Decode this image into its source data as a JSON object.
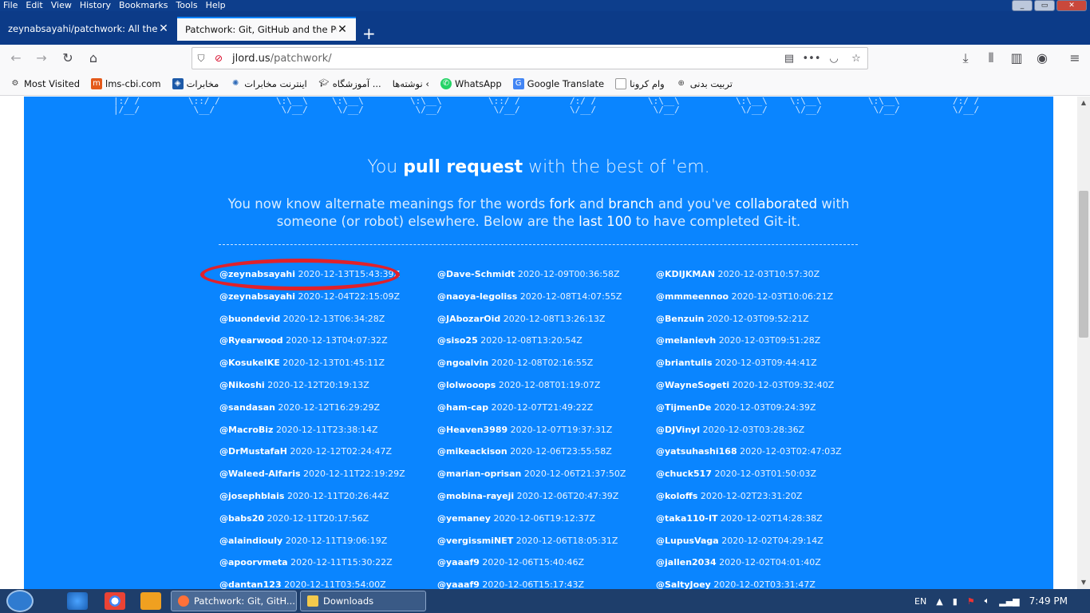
{
  "menubar": {
    "items": [
      "File",
      "Edit",
      "View",
      "History",
      "Bookmarks",
      "Tools",
      "Help"
    ]
  },
  "tabs": [
    {
      "label": "zeynabsayahi/patchwork: All the G"
    },
    {
      "label": "Patchwork: Git, GitHub and the Pursuit"
    }
  ],
  "urlbar": {
    "host": "jlord.us",
    "path": "/patchwork/"
  },
  "bookmarks": [
    {
      "label": "Most Visited",
      "icon": "gear-icon"
    },
    {
      "label": "lms-cbi.com",
      "icon": "lms-icon"
    },
    {
      "label": "مخابرات",
      "icon": "telecom-icon"
    },
    {
      "label": "اینترنت مخابرات",
      "icon": "globe-icon"
    },
    {
      "label": "آموزشگاه ...",
      "icon": "graduation-icon"
    },
    {
      "label": "نوشته‌ها ‹",
      "icon": "none"
    },
    {
      "label": "WhatsApp",
      "icon": "whatsapp-icon"
    },
    {
      "label": "Google Translate",
      "icon": "translate-icon"
    },
    {
      "label": "وام کرونا",
      "icon": "document-icon"
    },
    {
      "label": "تربیت بدنی",
      "icon": "globe-icon"
    }
  ],
  "page": {
    "headline_pre": "You ",
    "headline_bold": "pull request",
    "headline_post": " with the best of 'em.",
    "sub_1": "You now know alternate meanings for the words ",
    "sub_fork": "fork",
    "sub_2": " and ",
    "sub_branch": "branch",
    "sub_3": " and you've ",
    "sub_collab": "collaborated",
    "sub_4": " with someone (or robot) elsewhere. Below are the ",
    "sub_last": "last 100",
    "sub_5": " to have completed Git-it."
  },
  "completions": {
    "col1": [
      {
        "user": "@zeynabsayahi",
        "time": "2020-12-13T15:43:39Z"
      },
      {
        "user": "@zeynabsayahi",
        "time": "2020-12-04T22:15:09Z"
      },
      {
        "user": "@buondevid",
        "time": "2020-12-13T06:34:28Z"
      },
      {
        "user": "@Ryearwood",
        "time": "2020-12-13T04:07:32Z"
      },
      {
        "user": "@KosukeIKE",
        "time": "2020-12-13T01:45:11Z"
      },
      {
        "user": "@Nikoshi",
        "time": "2020-12-12T20:19:13Z"
      },
      {
        "user": "@sandasan",
        "time": "2020-12-12T16:29:29Z"
      },
      {
        "user": "@MacroBiz",
        "time": "2020-12-11T23:38:14Z"
      },
      {
        "user": "@DrMustafaH",
        "time": "2020-12-12T02:24:47Z"
      },
      {
        "user": "@Waleed-Alfaris",
        "time": "2020-12-11T22:19:29Z"
      },
      {
        "user": "@josephblais",
        "time": "2020-12-11T20:26:44Z"
      },
      {
        "user": "@babs20",
        "time": "2020-12-11T20:17:56Z"
      },
      {
        "user": "@alaindiouly",
        "time": "2020-12-11T19:06:19Z"
      },
      {
        "user": "@apoorvmeta",
        "time": "2020-12-11T15:30:22Z"
      },
      {
        "user": "@dantan123",
        "time": "2020-12-11T03:54:00Z"
      }
    ],
    "col2": [
      {
        "user": "@Dave-Schmidt",
        "time": "2020-12-09T00:36:58Z"
      },
      {
        "user": "@naoya-legoliss",
        "time": "2020-12-08T14:07:55Z"
      },
      {
        "user": "@JAbozarOid",
        "time": "2020-12-08T13:26:13Z"
      },
      {
        "user": "@siso25",
        "time": "2020-12-08T13:20:54Z"
      },
      {
        "user": "@ngoalvin",
        "time": "2020-12-08T02:16:55Z"
      },
      {
        "user": "@lolwooops",
        "time": "2020-12-08T01:19:07Z"
      },
      {
        "user": "@ham-cap",
        "time": "2020-12-07T21:49:22Z"
      },
      {
        "user": "@Heaven3989",
        "time": "2020-12-07T19:37:31Z"
      },
      {
        "user": "@mikeackison",
        "time": "2020-12-06T23:55:58Z"
      },
      {
        "user": "@marian-oprisan",
        "time": "2020-12-06T21:37:50Z"
      },
      {
        "user": "@mobina-rayeji",
        "time": "2020-12-06T20:47:39Z"
      },
      {
        "user": "@yemaney",
        "time": "2020-12-06T19:12:37Z"
      },
      {
        "user": "@vergissmiNET",
        "time": "2020-12-06T18:05:31Z"
      },
      {
        "user": "@yaaaf9",
        "time": "2020-12-06T15:40:46Z"
      },
      {
        "user": "@yaaaf9",
        "time": "2020-12-06T15:17:43Z"
      }
    ],
    "col3": [
      {
        "user": "@KDIJKMAN",
        "time": "2020-12-03T10:57:30Z"
      },
      {
        "user": "@mmmeennoo",
        "time": "2020-12-03T10:06:21Z"
      },
      {
        "user": "@Benzuin",
        "time": "2020-12-03T09:52:21Z"
      },
      {
        "user": "@melanievh",
        "time": "2020-12-03T09:51:28Z"
      },
      {
        "user": "@briantulis",
        "time": "2020-12-03T09:44:41Z"
      },
      {
        "user": "@WayneSogeti",
        "time": "2020-12-03T09:32:40Z"
      },
      {
        "user": "@TijmenDe",
        "time": "2020-12-03T09:24:39Z"
      },
      {
        "user": "@DJVinyl",
        "time": "2020-12-03T03:28:36Z"
      },
      {
        "user": "@yatsuhashi168",
        "time": "2020-12-03T02:47:03Z"
      },
      {
        "user": "@chuck517",
        "time": "2020-12-03T01:50:03Z"
      },
      {
        "user": "@koloffs",
        "time": "2020-12-02T23:31:20Z"
      },
      {
        "user": "@taka110-IT",
        "time": "2020-12-02T14:28:38Z"
      },
      {
        "user": "@LupusVaga",
        "time": "2020-12-02T04:29:14Z"
      },
      {
        "user": "@jallen2034",
        "time": "2020-12-02T04:01:40Z"
      },
      {
        "user": "@SaltyJoey",
        "time": "2020-12-02T03:31:47Z"
      }
    ]
  },
  "taskbar": {
    "tasks": [
      {
        "label": "Patchwork: Git, GitH..."
      },
      {
        "label": "Downloads"
      }
    ],
    "lang": "EN",
    "clock": "7:49 PM"
  },
  "colors": {
    "page_blue": "#0a85ff",
    "highlight_red": "#e0212b"
  }
}
